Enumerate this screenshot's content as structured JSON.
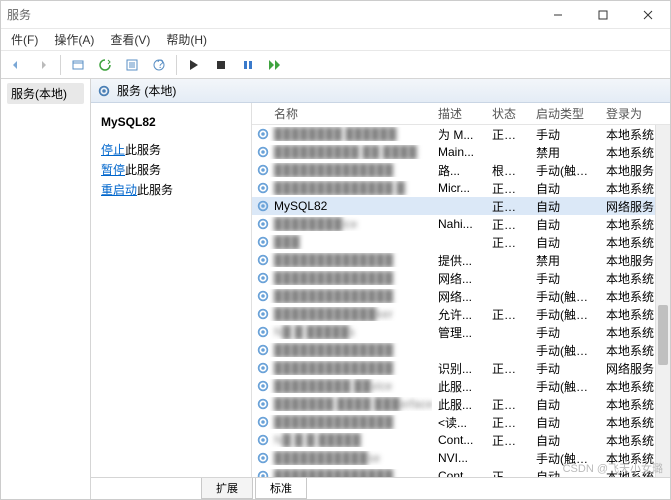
{
  "window": {
    "title": "服务"
  },
  "menu": {
    "file": "件(F)",
    "action": "操作(A)",
    "view": "查看(V)",
    "help": "帮助(H)"
  },
  "left_pane": {
    "node": "服务(本地)"
  },
  "pane_header": {
    "title": "服务 (本地)"
  },
  "detail": {
    "service_name": "MySQL82",
    "actions": [
      {
        "link": "停止",
        "suffix": "此服务"
      },
      {
        "link": "暂停",
        "suffix": "此服务"
      },
      {
        "link": "重启动",
        "suffix": "此服务"
      }
    ]
  },
  "columns": {
    "name": "名称",
    "desc": "描述",
    "status": "状态",
    "startup": "启动类型",
    "logon": "登录为"
  },
  "rows": [
    {
      "name": "████████ ██████",
      "blur": true,
      "desc": "为 M...",
      "status": "正在...",
      "startup": "手动",
      "logon": "本地系统"
    },
    {
      "name": "██████████ ██ ████",
      "blur": true,
      "desc": "Main...",
      "status": "",
      "startup": "禁用",
      "logon": "本地系统"
    },
    {
      "name": "██████████████",
      "blur": true,
      "desc": "路...",
      "status": "根据...",
      "startup": "手动(触发...",
      "logon": "本地服务"
    },
    {
      "name": "██████████████ █",
      "blur": true,
      "desc": "Micr...",
      "status": "正在...",
      "startup": "自动",
      "logon": "本地系统"
    },
    {
      "name": "MySQL82",
      "blur": false,
      "selected": true,
      "desc": "",
      "status": "正在...",
      "startup": "自动",
      "logon": "网络服务"
    },
    {
      "name": "████████ice",
      "blur": true,
      "desc": "Nahi...",
      "status": "正在...",
      "startup": "自动",
      "logon": "本地系统"
    },
    {
      "name": "███",
      "blur": true,
      "desc": "",
      "status": "正在...",
      "startup": "自动",
      "logon": "本地系统"
    },
    {
      "name": "██████████████",
      "blur": true,
      "desc": "提供...",
      "status": "",
      "startup": "禁用",
      "logon": "本地服务"
    },
    {
      "name": "██████████████",
      "blur": true,
      "desc": "网络...",
      "status": "",
      "startup": "手动",
      "logon": "本地系统"
    },
    {
      "name": "██████████████",
      "blur": true,
      "desc": "网络...",
      "status": "",
      "startup": "手动(触发...",
      "logon": "本地系统"
    },
    {
      "name": "████████████ker",
      "blur": true,
      "desc": "允许...",
      "status": "正在...",
      "startup": "手动(触发...",
      "logon": "本地系统"
    },
    {
      "name": "N█ █ █████s",
      "blur": true,
      "desc": "管理...",
      "status": "",
      "startup": "手动",
      "logon": "本地系统"
    },
    {
      "name": "██████████████",
      "blur": true,
      "desc": "",
      "status": "",
      "startup": "手动(触发...",
      "logon": "本地系统"
    },
    {
      "name": "██████████████",
      "blur": true,
      "desc": "识别...",
      "status": "正在...",
      "startup": "手动",
      "logon": "网络服务"
    },
    {
      "name": "█████████ ██vice",
      "blur": true,
      "desc": "此服...",
      "status": "",
      "startup": "手动(触发...",
      "logon": "本地系统"
    },
    {
      "name": "███████ ████ ███erface S...",
      "blur": true,
      "desc": "此服...",
      "status": "正在...",
      "startup": "自动",
      "logon": "本地系统"
    },
    {
      "name": "██████████████",
      "blur": true,
      "desc": "<读...",
      "status": "正在...",
      "startup": "自动",
      "logon": "本地系统"
    },
    {
      "name": "N█ █ █ █████",
      "blur": true,
      "desc": "Cont...",
      "status": "正在...",
      "startup": "自动",
      "logon": "本地系统"
    },
    {
      "name": "███████████se",
      "blur": true,
      "desc": "NVI...",
      "status": "",
      "startup": "手动(触发...",
      "logon": "本地系统"
    },
    {
      "name": "██████████████",
      "blur": true,
      "desc": "Cont...",
      "status": "正在...",
      "startup": "自动",
      "logon": "本地系统"
    }
  ],
  "tabs": {
    "extended": "扩展",
    "standard": "标准"
  },
  "watermark": "CSDN @飞天小女璐"
}
